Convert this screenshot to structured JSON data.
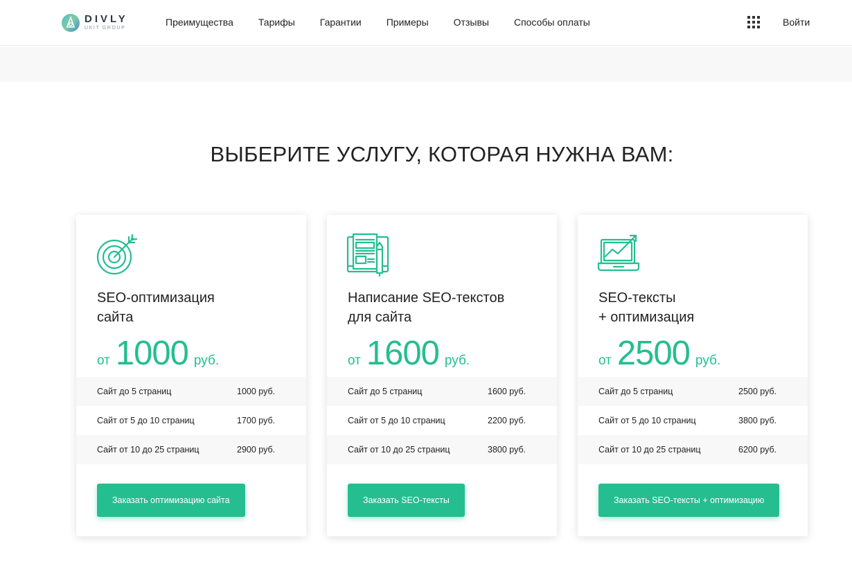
{
  "header": {
    "logo": {
      "name": "DIVLY",
      "sub": "UKIT GROUP"
    },
    "nav": [
      {
        "label": "Преимущества"
      },
      {
        "label": "Тарифы"
      },
      {
        "label": "Гарантии"
      },
      {
        "label": "Примеры"
      },
      {
        "label": "Отзывы"
      },
      {
        "label": "Способы оплаты"
      }
    ],
    "apps_icon": "grid-icon",
    "login_label": "Войти"
  },
  "section": {
    "title": "ВЫБЕРИТЕ УСЛУГУ, КОТОРАЯ НУЖНА ВАМ:"
  },
  "cards": [
    {
      "icon": "target-icon",
      "title_line1": "SEO-оптимизация",
      "title_line2": "сайта",
      "price_from": "от",
      "price_value": "1000",
      "price_unit": "руб.",
      "rows": [
        {
          "label": "Сайт до 5 страниц",
          "price": "1000 руб."
        },
        {
          "label": "Сайт от 5 до 10 страниц",
          "price": "1700 руб."
        },
        {
          "label": "Сайт от 10 до 25 страниц",
          "price": "2900 руб."
        }
      ],
      "button_label": "Заказать оптимизацию сайта"
    },
    {
      "icon": "document-pencil-icon",
      "title_line1": "Написание SEO-текстов",
      "title_line2": "для сайта",
      "price_from": "от",
      "price_value": "1600",
      "price_unit": "руб.",
      "rows": [
        {
          "label": "Сайт до 5 страниц",
          "price": "1600 руб."
        },
        {
          "label": "Сайт от 5 до 10 страниц",
          "price": "2200 руб."
        },
        {
          "label": "Сайт от 10 до 25 страниц",
          "price": "3800 руб."
        }
      ],
      "button_label": "Заказать SEO-тексты"
    },
    {
      "icon": "laptop-growth-icon",
      "title_line1": "SEO-тексты",
      "title_line2": "+ оптимизация",
      "price_from": "от",
      "price_value": "2500",
      "price_unit": "руб.",
      "rows": [
        {
          "label": "Сайт до 5 страниц",
          "price": "2500 руб."
        },
        {
          "label": "Сайт от 5 до 10 страниц",
          "price": "3800 руб."
        },
        {
          "label": "Сайт от 10 до 25 страниц",
          "price": "6200 руб."
        }
      ],
      "button_label": "Заказать SEO-тексты + оптимизацию"
    }
  ],
  "colors": {
    "accent": "#24be90",
    "text": "#222222",
    "band": "#f8f8f8"
  }
}
